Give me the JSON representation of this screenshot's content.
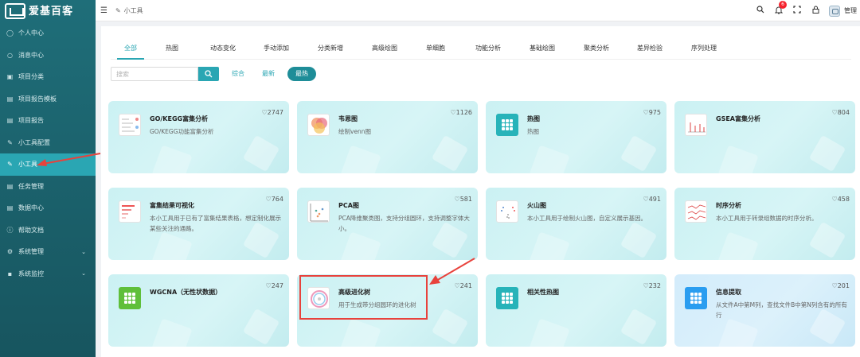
{
  "app": {
    "logo_text": "爱基百客"
  },
  "sidebar": {
    "items": [
      {
        "label": "个人中心",
        "icon": "user-icon"
      },
      {
        "label": "消息中心",
        "icon": "message-icon"
      },
      {
        "label": "项目分类",
        "icon": "folder-icon"
      },
      {
        "label": "项目报告模板",
        "icon": "template-icon"
      },
      {
        "label": "项目报告",
        "icon": "report-icon"
      },
      {
        "label": "小工具配置",
        "icon": "edit-icon"
      },
      {
        "label": "小工具",
        "icon": "tool-icon",
        "active": true
      },
      {
        "label": "任务管理",
        "icon": "task-icon"
      },
      {
        "label": "数据中心",
        "icon": "data-icon"
      },
      {
        "label": "帮助文档",
        "icon": "help-icon"
      },
      {
        "label": "系统管理",
        "icon": "gear-icon",
        "expandable": true
      },
      {
        "label": "系统监控",
        "icon": "monitor-icon",
        "expandable": true
      }
    ]
  },
  "header": {
    "breadcrumb": "小工具",
    "notification_count": "6",
    "user_name": "管理"
  },
  "tabs": [
    "全部",
    "热图",
    "动态变化",
    "手动添加",
    "分类新增",
    "高级绘图",
    "单细胞",
    "功能分析",
    "基础绘图",
    "聚类分析",
    "差异检验",
    "序列处理"
  ],
  "active_tab": 0,
  "search": {
    "placeholder": "搜索"
  },
  "sort": {
    "options": [
      "综合",
      "最新",
      "最热"
    ],
    "active": 2
  },
  "colors": {
    "accent": "#2aa6b3",
    "sidebar": "#1f6e79",
    "highlight": "#e8423c"
  },
  "cards": [
    {
      "title": "GO/KEGG富集分析",
      "desc": "GO/KEGG功能富集分析",
      "likes": "2747",
      "thumb": "go-kegg-thumbnail"
    },
    {
      "title": "韦恩图",
      "desc": "绘制venn图",
      "likes": "1126",
      "thumb": "venn-thumbnail"
    },
    {
      "title": "热图",
      "desc": "热图",
      "likes": "975",
      "thumb": "heatmap-tile-icon"
    },
    {
      "title": "GSEA富集分析",
      "desc": "",
      "likes": "804",
      "thumb": "gsea-thumbnail"
    },
    {
      "title": "富集结果可视化",
      "desc": "本小工具用于已有了富集结果表格，想定制化展示某些关注的通路。",
      "likes": "764",
      "thumb": "enrichment-thumbnail"
    },
    {
      "title": "PCA图",
      "desc": "PCA降维聚类图，支持分组圆环，支持调整字体大小。",
      "likes": "581",
      "thumb": "pca-thumbnail"
    },
    {
      "title": "火山图",
      "desc": "本小工具用于绘制火山图，自定义展示基因。",
      "likes": "491",
      "thumb": "volcano-thumbnail"
    },
    {
      "title": "时序分析",
      "desc": "本小工具用于转录组数据的时序分析。",
      "likes": "458",
      "thumb": "timeseries-thumbnail"
    },
    {
      "title": "WGCNA（无性状数据）",
      "desc": "",
      "likes": "247",
      "thumb": "wgcna-tile-icon"
    },
    {
      "title": "高级进化树",
      "desc": "用于生成带分组圆环的进化树",
      "likes": "241",
      "thumb": "phylo-tree-thumbnail"
    },
    {
      "title": "相关性热图",
      "desc": "",
      "likes": "232",
      "thumb": "correlation-tile-icon"
    },
    {
      "title": "信息提取",
      "desc": "从文件A中第M列，查找文件B中第N列含有的所有行",
      "likes": "201",
      "thumb": "extract-tile-icon"
    }
  ]
}
